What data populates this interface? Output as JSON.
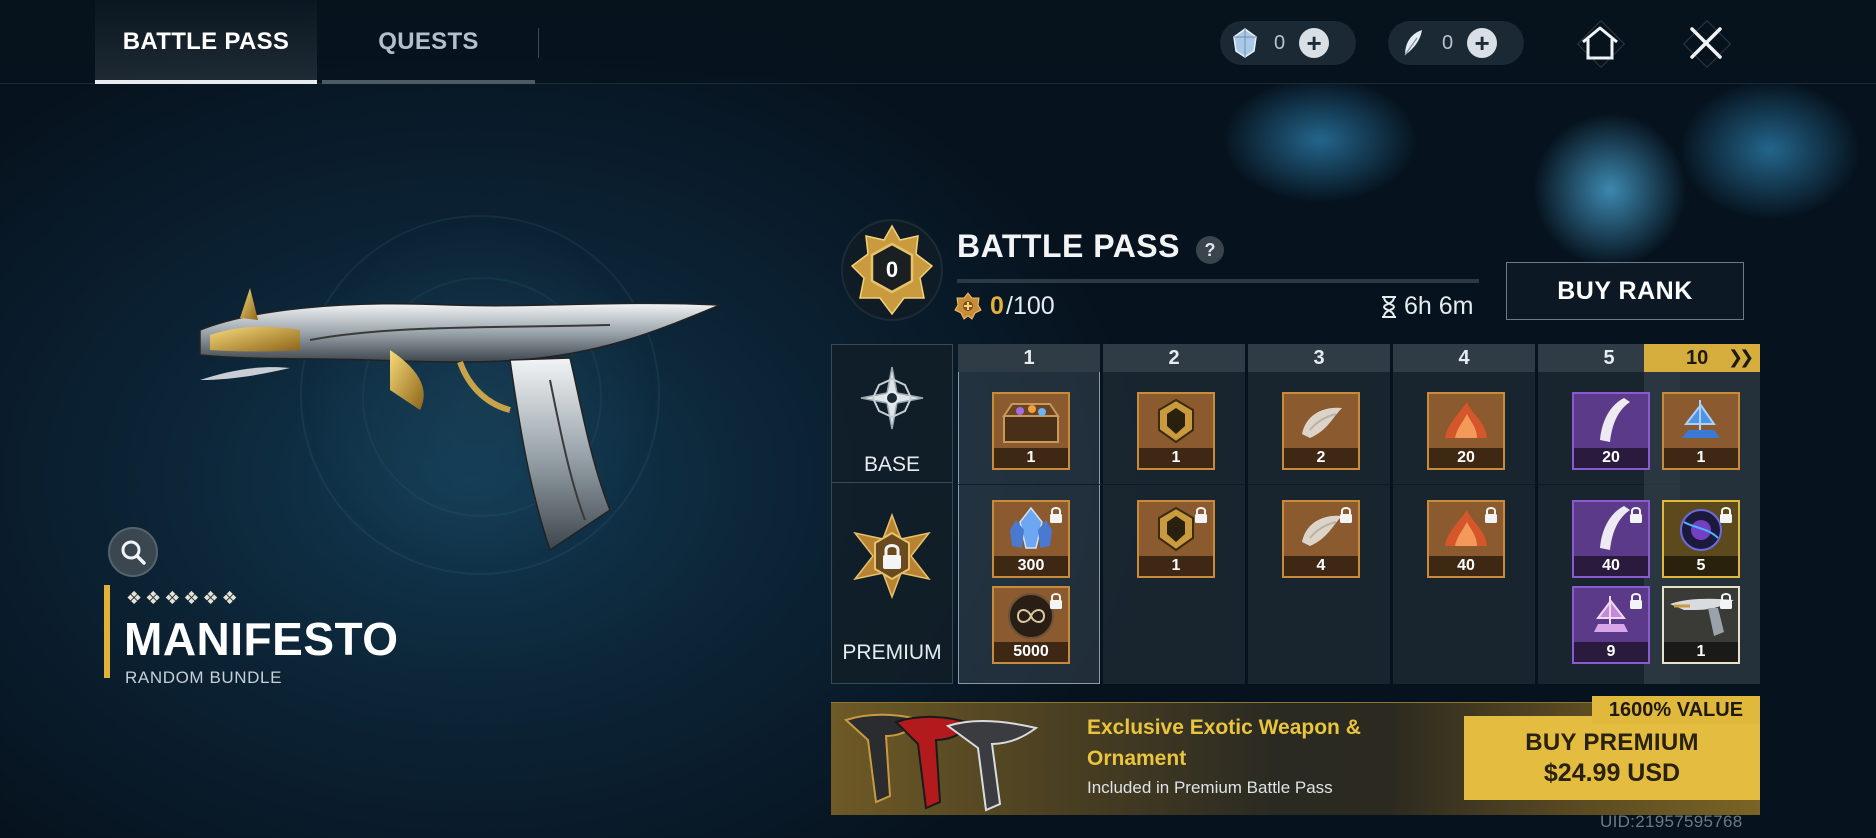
{
  "tabs": {
    "battle_pass": "BATTLE PASS",
    "quests": "QUESTS"
  },
  "currencies": [
    {
      "icon": "crystal-icon",
      "value": "0"
    },
    {
      "icon": "feather-icon",
      "value": "0"
    }
  ],
  "weapon": {
    "rarity": "❖❖❖❖❖❖",
    "name": "MANIFESTO",
    "type": "RANDOM BUNDLE"
  },
  "battle_pass": {
    "rank": "0",
    "title": "BATTLE PASS",
    "help": "?",
    "xp_current": "0",
    "xp_max": "/100",
    "xp_progress": 0,
    "time_left": "6h 6m",
    "buy_rank": "BUY RANK"
  },
  "tracks": {
    "base": "BASE",
    "premium": "PREMIUM"
  },
  "levels": [
    "1",
    "2",
    "3",
    "4",
    "5",
    "10"
  ],
  "rewards": {
    "l1_base": "1",
    "l1_prem_a": "300",
    "l1_prem_b": "5000",
    "l2_base": "1",
    "l2_prem": "1",
    "l3_base": "2",
    "l3_prem": "4",
    "l4_base": "20",
    "l4_prem": "40",
    "l5_base": "20",
    "l5_prem_a": "40",
    "l5_prem_b": "9",
    "l10_base": "1",
    "l10_prem_a": "5",
    "l10_prem_b": "1"
  },
  "premium_banner": {
    "title": "Exclusive Exotic Weapon & Ornament",
    "subtitle": "Included in Premium Battle Pass",
    "value_tag": "1600% VALUE",
    "button_line1": "BUY PREMIUM",
    "button_line2": "$24.99 USD"
  },
  "uid": "UID:21957595768",
  "colors": {
    "accent_gold": "#e2b13a",
    "bg": "#0a1c2a"
  }
}
